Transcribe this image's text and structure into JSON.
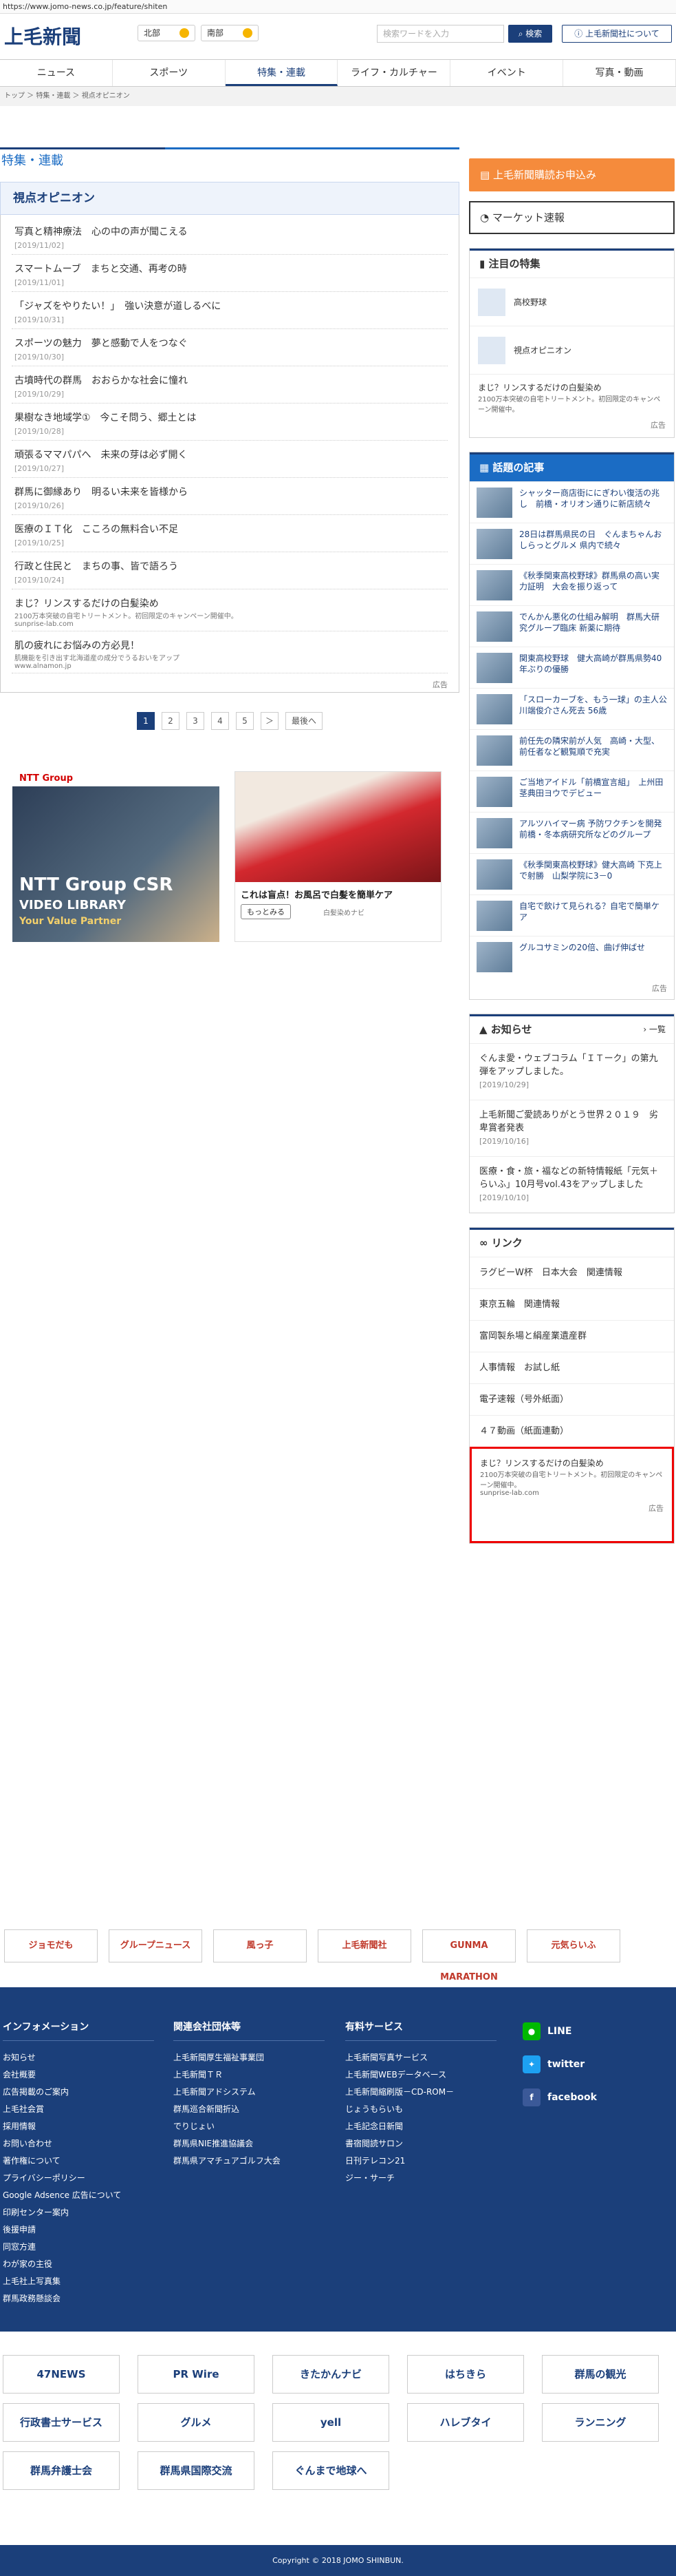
{
  "url": "https://www.jomo-news.co.jp/feature/shiten",
  "logo": "上毛新聞",
  "weather": [
    {
      "label": "北部"
    },
    {
      "label": "南部"
    }
  ],
  "search": {
    "placeholder": "検索ワードを入力",
    "button": "検索"
  },
  "about": "上毛新聞社について",
  "nav": [
    "ニュース",
    "スポーツ",
    "特集・連載",
    "ライフ・カルチャー",
    "イベント",
    "写真・動画"
  ],
  "breadcrumb": "トップ ＞ 特集・連載 ＞ 視点オピニオン",
  "section": "特集・連載",
  "subsection": "視点オピニオン",
  "articles": [
    {
      "t": "写真と精神療法　心の中の声が聞こえる",
      "d": "[2019/11/02]"
    },
    {
      "t": "スマートムーブ　まちと交通、再考の時",
      "d": "[2019/11/01]"
    },
    {
      "t": "「ジャズをやりたい！」　強い決意が道しるべに",
      "d": "[2019/10/31]"
    },
    {
      "t": "スポーツの魅力　夢と感動で人をつなぐ",
      "d": "[2019/10/30]"
    },
    {
      "t": "古墳時代の群馬　おおらかな社会に憧れ",
      "d": "[2019/10/29]"
    },
    {
      "t": "果樹なき地域学①　今こそ問う、郷土とは",
      "d": "[2019/10/28]"
    },
    {
      "t": "頑張るママパパへ　未来の芽は必ず開く",
      "d": "[2019/10/27]"
    },
    {
      "t": "群馬に御縁あり　明るい未来を皆様から",
      "d": "[2019/10/26]"
    },
    {
      "t": "医療のＩＴ化　こころの無料合い不足",
      "d": "[2019/10/25]"
    },
    {
      "t": "行政と住民と　まちの事、皆で語ろう",
      "d": "[2019/10/24]"
    }
  ],
  "inline_ads": [
    {
      "t": "まじ？リンスするだけの白髪染め",
      "s": "2100万本突破の自宅トリートメント。初回限定のキャンペーン開催中。",
      "u": "sunprise-lab.com"
    },
    {
      "t": "肌の疲れにお悩みの方必見！",
      "s": "肌機能を引き出す北海道産の成分でうるおいをアップ",
      "u": "www.alnamon.jp"
    }
  ],
  "ad_label": "広告",
  "pager": [
    "1",
    "2",
    "3",
    "4",
    "5",
    "＞",
    "最後へ"
  ],
  "ad_ntt": {
    "top": "NTT Group",
    "big": "NTT Group CSR",
    "mid": "VIDEO LIBRARY",
    "low": "Your Value Partner"
  },
  "ad_bath": {
    "cap": "これは盲点！お風呂で白髪を簡単ケア",
    "btn": "もっとみる",
    "src": "白髪染めナビ"
  },
  "cta": "上毛新聞購読お申込み",
  "market": "マーケット速報",
  "pick_title": "注目の特集",
  "picks": [
    "高校野球",
    "視点オピニオン"
  ],
  "pick_ad": {
    "t": "まじ？リンスするだけの白髪染め",
    "s": "2100万本突破の自宅トリートメント。初回限定のキャンペーン開催中。"
  },
  "rank_title": "話題の記事",
  "ranks": [
    "シャッター商店街ににぎわい復活の兆し　前橋・オリオン通りに新店続々",
    "28日は群馬県民の日　ぐんまちゃんおしらっとグルメ 県内で続々",
    "《秋季関東高校野球》群馬県の高い実力証明　大会を振り返って",
    "でんかん悪化の仕組み解明　群馬大研究グループ臨床 新薬に期待",
    "関東高校野球　健大高崎が群馬県勢40年ぶりの優勝",
    "「スローカーブを、もう一球」の主人公 川端俊介さん死去 56歳",
    "前任先の隣宋前が人気　高崎・大型、前任者など観覧順で充実",
    "ご当地アイドル「前橋宣言組」　上州田茎典田ヨウでデビュー",
    "アルツハイマー病 予防ワクチンを開発 前橋・冬本病研究所などのグループ",
    "《秋季関東高校野球》健大高崎 下克上で射勝　山梨学院に3－0",
    "自宅で飲けて見られる？自宅で簡単ケア",
    "グルコサミンの20倍、曲げ伸ばせ"
  ],
  "notice_title": "お知らせ",
  "notice_more": "一覧",
  "notices": [
    {
      "t": "ぐんま愛・ウェブコラム「ＩＴーク」の第九弾をアップしました。",
      "d": "[2019/10/29]"
    },
    {
      "t": "上毛新聞ご愛読ありがとう世界２０１９　劣卑賞者発表",
      "d": "[2019/10/16]"
    },
    {
      "t": "医療・食・旅・福などの新特情報紙「元気＋らいふ」10月号vol.43をアップしました",
      "d": "[2019/10/10]"
    }
  ],
  "link_title": "リンク",
  "links": [
    "ラグビーW杯　日本大会　関連情報",
    "東京五輪　関連情報",
    "富岡製糸場と絹産業遺産群",
    "人事情報　お試し紙",
    "電子速報（号外紙面）",
    "４７動画（紙面連動）"
  ],
  "red_ad": {
    "t": "まじ？リンスするだけの白髪染め",
    "s": "2100万本突破の自宅トリートメント。初回限定のキャンペーン開催中。",
    "u": "sunprise-lab.com"
  },
  "banners": [
    "ジョモだも",
    "グループニュース",
    "風っ子",
    "上毛新聞社",
    "GUNMA MARATHON",
    "元気らいふ"
  ],
  "footer": {
    "col1": {
      "h": "インフォメーション",
      "items": [
        "お知らせ",
        "会社概要",
        "広告掲載のご案内",
        "上毛社会賞",
        "採用情報",
        "お問い合わせ",
        "著作権について",
        "プライバシーポリシー",
        "Google Adsence 広告について",
        "印刷センター案内",
        "後援申請",
        "同窓方連",
        "わが家の主役",
        "上毛社上写真集",
        "群馬政務懸談会"
      ]
    },
    "col2": {
      "h": "関連会社団体等",
      "items": [
        "上毛新聞厚生福祉事業団",
        "上毛新聞ＴＲ",
        "上毛新聞アドシステム",
        "群馬巡合新聞折込",
        "でりじょい",
        "群馬県NIE推進協議会",
        "群馬県アマチュアゴルフ大会"
      ]
    },
    "col3": {
      "h": "有料サービス",
      "items": [
        "上毛新聞写真サービス",
        "上毛新聞WEBデータベース",
        "上毛新聞縮刷版－CD-ROM－",
        "じょうもらいも",
        "上毛記念日新聞",
        "書宿閲読サロン",
        "日刊テレコン21",
        "ジー・サーチ"
      ]
    },
    "social": [
      "LINE",
      "twitter",
      "facebook"
    ]
  },
  "lower_banners": [
    "47NEWS",
    "PR Wire",
    "きたかんナビ",
    "はちきら",
    "群馬の観光",
    "行政書士サービス",
    "グルメ",
    "yell",
    "ハレブタイ",
    "ランニング",
    "群馬弁護士会",
    "群馬県国際交流",
    "ぐんまで地球へ"
  ],
  "copyright": "Copyright © 2018 JOMO SHINBUN."
}
